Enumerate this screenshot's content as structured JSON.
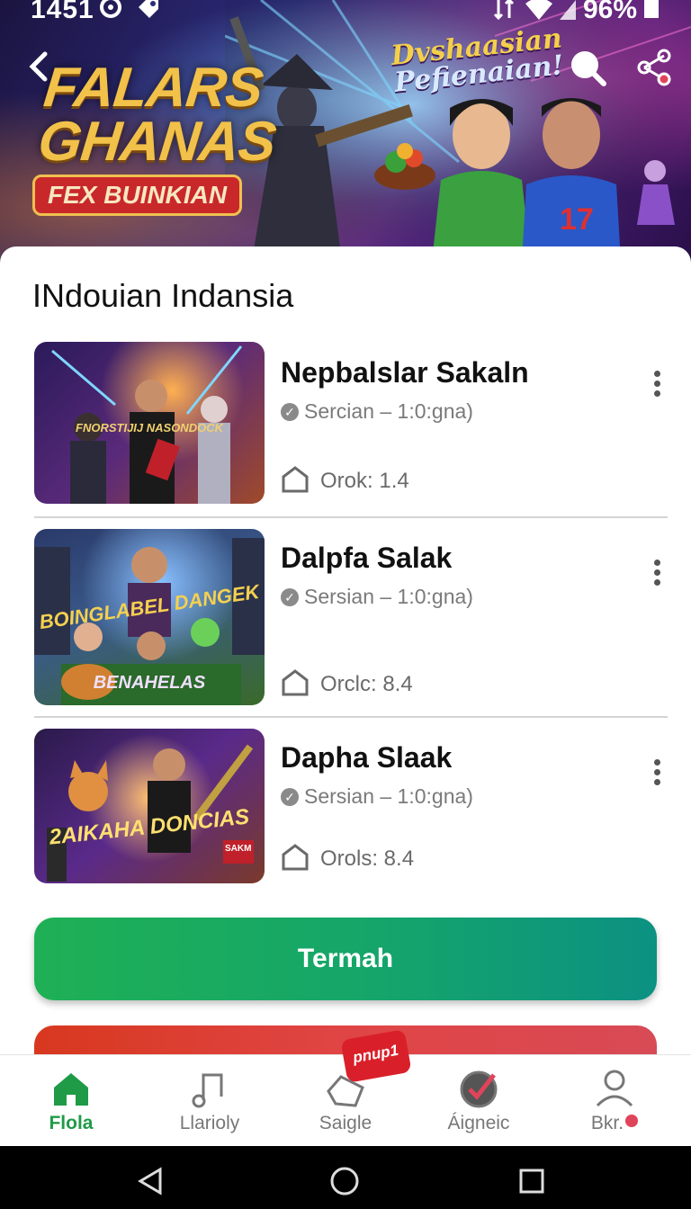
{
  "status_bar": {
    "time": "1451",
    "battery": "96%"
  },
  "hero": {
    "title_line1": "FALARS",
    "title_line2": "GHANAS",
    "badge": "FEX BUINKIAN",
    "script_line1": "Dvshaasian",
    "script_line2": "Pefienaian!"
  },
  "section": {
    "title": "INdouian Indansia"
  },
  "games": [
    {
      "title": "Nepbalslar Sakaln",
      "sub": "Sercian – 1:0:gna)",
      "meta": "Orok: 1.4",
      "thumb_text": "FNORSTIJIJ NASONDOCK",
      "thumb_colors": [
        "#3a2a6a",
        "#b24a2a"
      ]
    },
    {
      "title": "Dalpfa Salak",
      "sub": "Sersian – 1:0:gna)",
      "meta": "Orclc: 8.4",
      "thumb_text": "BOINGLABEL DANGEK",
      "thumb_text2": "BENAHELAS",
      "thumb_colors": [
        "#2a4a7a",
        "#3a7a3a"
      ]
    },
    {
      "title": "Dapha Slaak",
      "sub": "Sersian – 1:0:gna)",
      "meta": "Orols: 8.4",
      "thumb_text": "2AIKAHA DONCIAS",
      "thumb_text2": "SAKM",
      "thumb_colors": [
        "#4a2a7a",
        "#c26a2a"
      ]
    }
  ],
  "buttons": {
    "primary": "Termah"
  },
  "bottom_nav": {
    "promo": "pnup1",
    "items": [
      {
        "label": "Flola",
        "icon": "home-icon"
      },
      {
        "label": "Llarioly",
        "icon": "music-note-icon"
      },
      {
        "label": "Saigle",
        "icon": "ticket-icon"
      },
      {
        "label": "Áigneic",
        "icon": "badge-check-icon"
      },
      {
        "label": "Bkr.",
        "icon": "profile-icon"
      }
    ]
  },
  "colors": {
    "accent_green": "#1f9b48",
    "button_green": "#15a56a",
    "alert_red": "#d9202a"
  }
}
